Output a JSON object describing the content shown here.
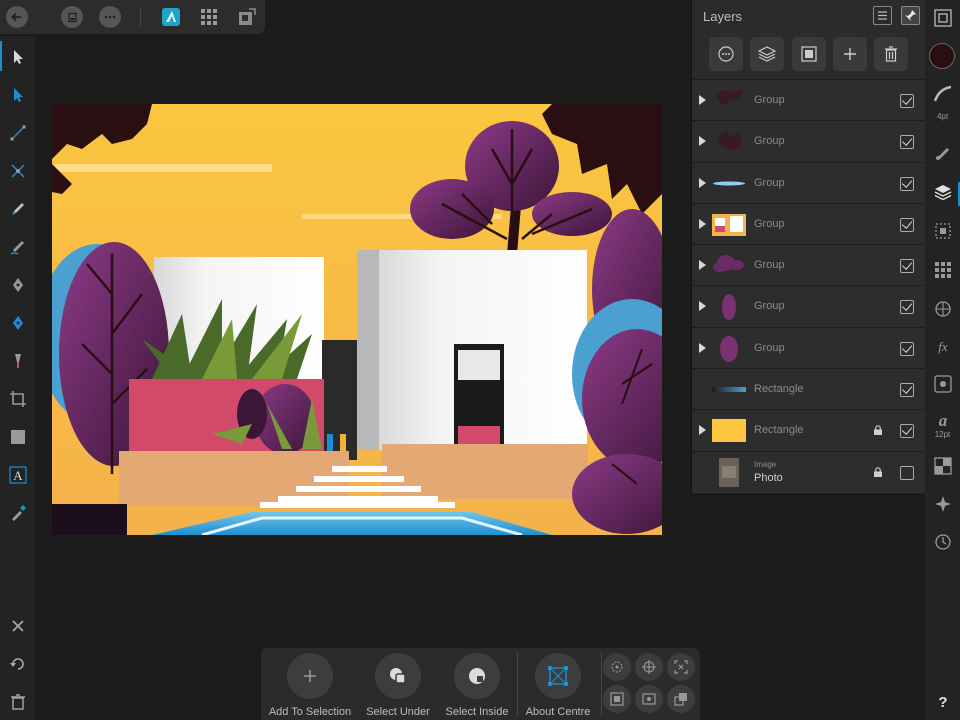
{
  "top_toolbar": {
    "back_icon": "back-arrow-icon",
    "document_icon": "document-icon",
    "more_icon": "ellipsis-icon",
    "persona_designer_icon": "designer-persona-icon",
    "persona_pixel_icon": "pixel-persona-icon",
    "persona_export_icon": "export-persona-icon"
  },
  "left_tools": [
    "move-tool-icon",
    "node-tool-icon",
    "point-transform-tool-icon",
    "corner-tool-icon",
    "pencil-tool-icon",
    "vector-brush-tool-icon",
    "pen-tool-icon",
    "fill-tool-icon",
    "transparency-tool-icon",
    "crop-tool-icon",
    "rectangle-tool-icon",
    "text-tool-icon",
    "color-picker-tool-icon"
  ],
  "left_bottom": [
    "close-icon",
    "undo-icon",
    "trash-icon"
  ],
  "layers_panel": {
    "title": "Layers",
    "rows": [
      {
        "name": "Group",
        "expandable": true,
        "visible": true,
        "locked": false
      },
      {
        "name": "Group",
        "expandable": true,
        "visible": true,
        "locked": false
      },
      {
        "name": "Group",
        "expandable": true,
        "visible": true,
        "locked": false
      },
      {
        "name": "Group",
        "expandable": true,
        "visible": true,
        "locked": false
      },
      {
        "name": "Group",
        "expandable": true,
        "visible": true,
        "locked": false
      },
      {
        "name": "Group",
        "expandable": true,
        "visible": true,
        "locked": false
      },
      {
        "name": "Group",
        "expandable": true,
        "visible": true,
        "locked": false
      },
      {
        "name": "Rectangle",
        "expandable": false,
        "visible": true,
        "locked": false
      },
      {
        "name": "Rectangle",
        "expandable": true,
        "visible": true,
        "locked": true
      },
      {
        "type_label": "Image",
        "name": "Photo",
        "expandable": false,
        "visible": false,
        "locked": true
      }
    ]
  },
  "studio": {
    "stroke_width": "4pt",
    "text_size": "12pt",
    "help": "?",
    "color_swatch": "#2a0f12"
  },
  "context_toolbar": {
    "add_to_selection": "Add To Selection",
    "select_under": "Select Under",
    "select_inside": "Select Inside",
    "about_centre": "About Centre"
  },
  "colors": {
    "accent": "#1a8fd6",
    "sky": "#f9c042",
    "plum": "#6a2a62",
    "pink": "#d14a6a",
    "tan": "#e3a873"
  }
}
